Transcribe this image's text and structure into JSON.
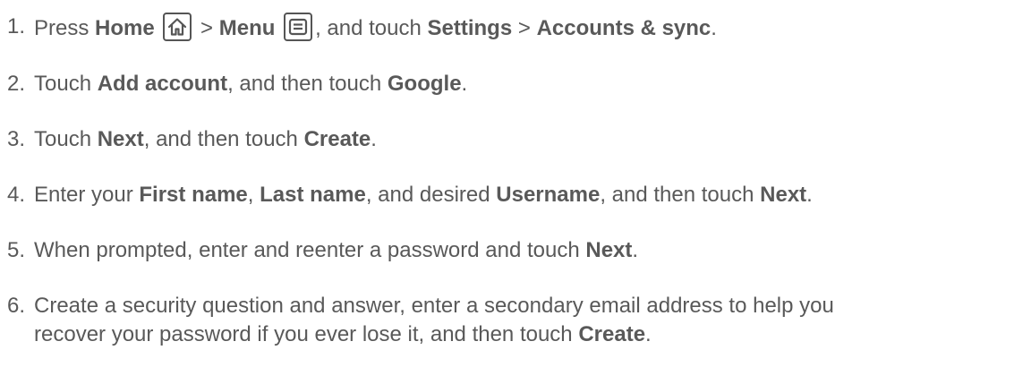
{
  "steps": [
    {
      "number": "1.",
      "parts": {
        "t1": "Press ",
        "b1": "Home",
        "t2": " > ",
        "b2": "Menu",
        "t3": ", and touch ",
        "b3": "Settings",
        "t4": " > ",
        "b4": "Accounts & sync",
        "t5": "."
      },
      "icons": [
        "home-icon",
        "menu-icon"
      ]
    },
    {
      "number": "2.",
      "parts": {
        "t1": "Touch ",
        "b1": "Add account",
        "t2": ", and then touch ",
        "b2": "Google",
        "t3": "."
      }
    },
    {
      "number": "3.",
      "parts": {
        "t1": "Touch ",
        "b1": "Next",
        "t2": ", and then touch ",
        "b2": "Create",
        "t3": "."
      }
    },
    {
      "number": "4.",
      "parts": {
        "t1": "Enter your ",
        "b1": "First name",
        "t2": ", ",
        "b2": "Last name",
        "t3": ", and desired ",
        "b3": "Username",
        "t4": ", and then touch ",
        "b4": "Next",
        "t5": "."
      }
    },
    {
      "number": "5.",
      "parts": {
        "t1": "When prompted, enter and reenter a password and touch ",
        "b1": "Next",
        "t2": "."
      }
    },
    {
      "number": "6.",
      "parts": {
        "line1": "Create a security question and answer, enter a secondary email address to help you",
        "t1": "recover your password if you ever lose it, and then touch ",
        "b1": "Create",
        "t2": "."
      }
    }
  ],
  "colors": {
    "text": "#595959",
    "icon_border": "#555555"
  }
}
